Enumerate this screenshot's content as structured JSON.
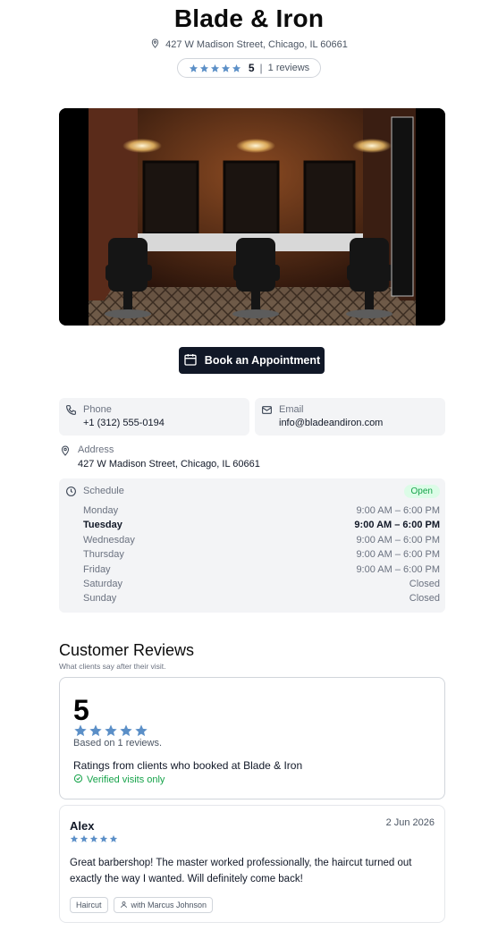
{
  "shop": {
    "name": "Blade & Iron",
    "address": "427 W Madison Street, Chicago, IL 60661",
    "rating": "5",
    "separator": "|",
    "review_count_label": "1 reviews"
  },
  "hero": {
    "icon": "barbershop-photo"
  },
  "actions": {
    "book_label": "Book an Appointment"
  },
  "contact": {
    "phone_label": "Phone",
    "phone": "+1 (312) 555-0194",
    "email_label": "Email",
    "email": "info@bladeandiron.com",
    "address_label": "Address",
    "address": "427 W Madison Street, Chicago, IL 60661"
  },
  "schedule": {
    "label": "Schedule",
    "status": "Open",
    "days": [
      {
        "day": "Monday",
        "hours": "9:00 AM – 6:00 PM"
      },
      {
        "day": "Tuesday",
        "hours": "9:00 AM – 6:00 PM"
      },
      {
        "day": "Wednesday",
        "hours": "9:00 AM – 6:00 PM"
      },
      {
        "day": "Thursday",
        "hours": "9:00 AM – 6:00 PM"
      },
      {
        "day": "Friday",
        "hours": "9:00 AM – 6:00 PM"
      },
      {
        "day": "Saturday",
        "hours": "Closed"
      },
      {
        "day": "Sunday",
        "hours": "Closed"
      }
    ],
    "active_day": "Tuesday"
  },
  "reviews": {
    "title": "Customer Reviews",
    "subtitle": "What clients say after their visit.",
    "summary": {
      "score": "5",
      "based_on": "Based on 1 reviews.",
      "ratings_from": "Ratings from clients who booked at Blade & Iron",
      "verified": "Verified visits only"
    },
    "items": [
      {
        "author": "Alex",
        "date": "2 Jun 2026",
        "stars": 5,
        "text": "Great barbershop! The master worked professionally, the haircut turned out exactly the way I wanted. Will definitely come back!",
        "service_tag": "Haircut",
        "master_tag": "with Marcus Johnson"
      }
    ]
  },
  "colors": {
    "star": "#5b8fc7",
    "button_bg": "#111827",
    "card_bg": "#f3f4f6",
    "open_badge_bg": "#dcfce7",
    "verified": "#16a34a"
  }
}
